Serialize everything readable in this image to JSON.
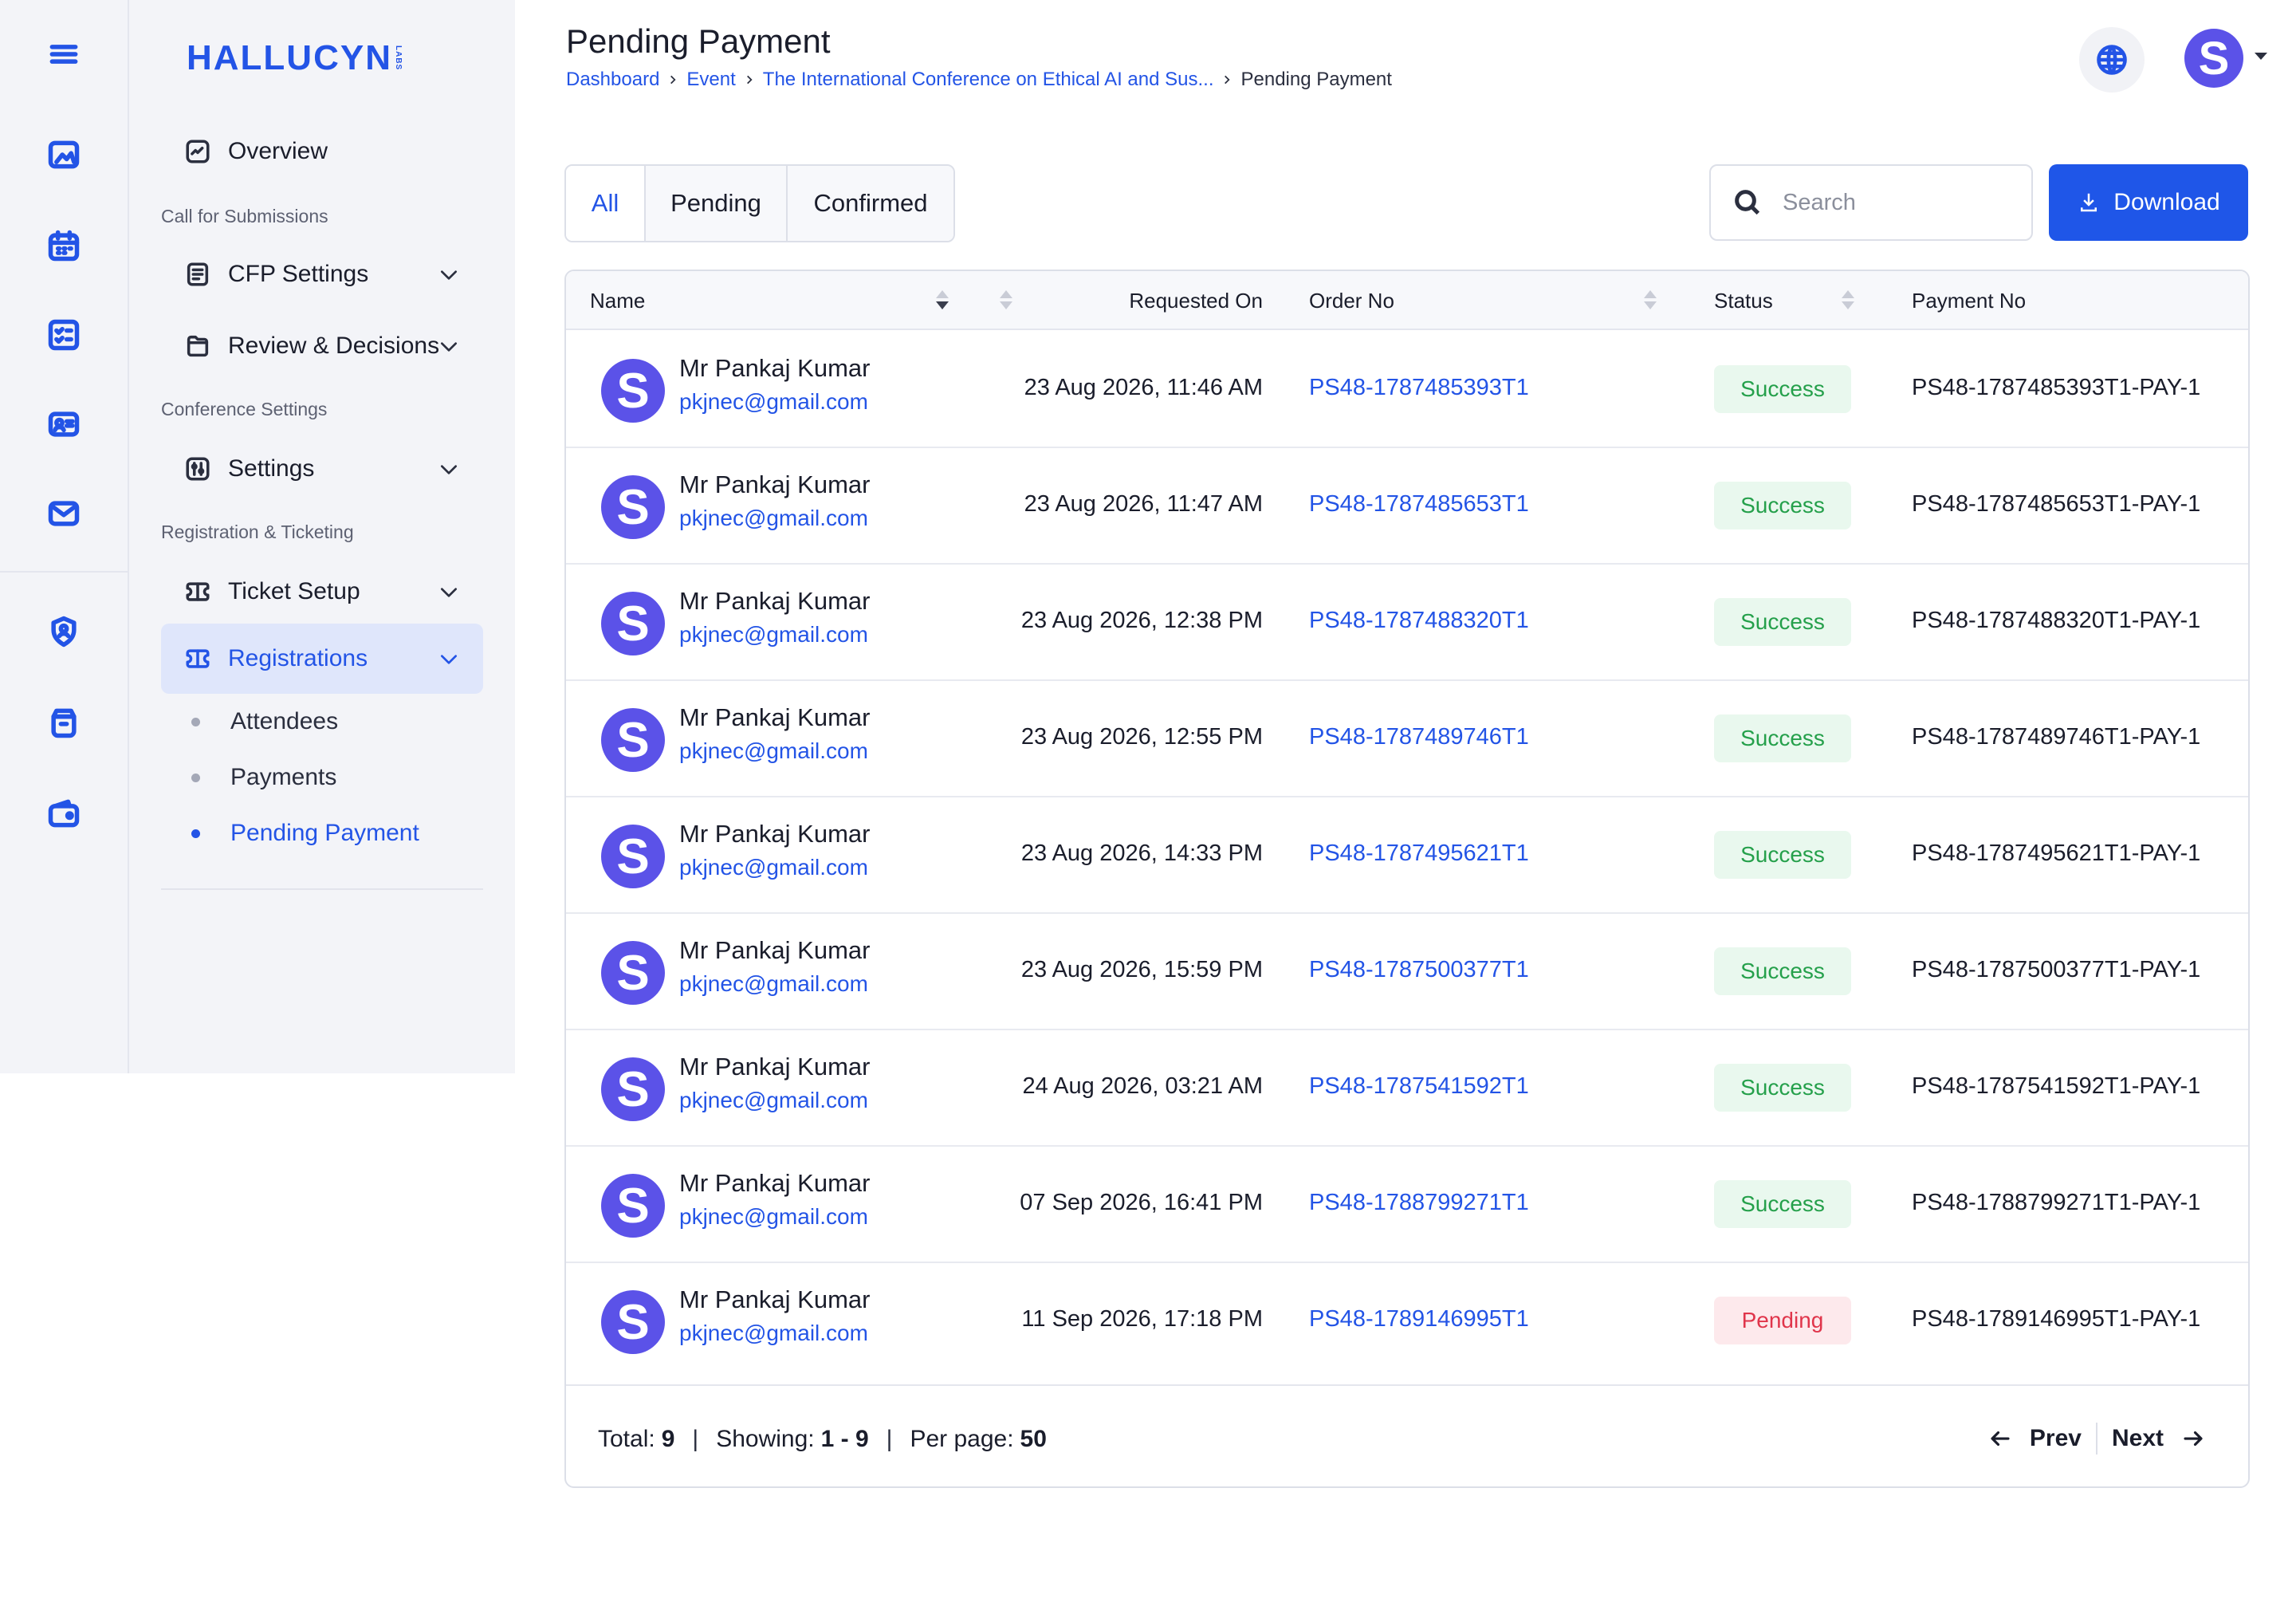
{
  "brand": {
    "name": "HALLUCYN",
    "suffix": "LABS",
    "color": "#2354e6"
  },
  "rail": {
    "icons": [
      "menu-icon",
      "image-icon",
      "calendar-icon",
      "checklist-icon",
      "id-card-icon",
      "mail-icon",
      "shield-user-icon",
      "archive-icon",
      "wallet-icon"
    ]
  },
  "sidebar": {
    "overview": "Overview",
    "section_cfs": "Call for Submissions",
    "cfp_settings": "CFP Settings",
    "review_decisions": "Review & Decisions",
    "section_conf": "Conference Settings",
    "settings": "Settings",
    "section_reg": "Registration & Ticketing",
    "ticket_setup": "Ticket Setup",
    "registrations": "Registrations",
    "sub_items": [
      "Attendees",
      "Payments",
      "Pending Payment"
    ],
    "active_sub": "Pending Payment"
  },
  "header": {
    "title": "Pending Payment",
    "breadcrumb": [
      "Dashboard",
      "Event",
      "The International Conference on Ethical AI and Sus...",
      "Pending Payment"
    ],
    "user_initial": "S"
  },
  "tabs": [
    {
      "label": "All",
      "active": true
    },
    {
      "label": "Pending",
      "active": false
    },
    {
      "label": "Confirmed",
      "active": false
    }
  ],
  "search": {
    "placeholder": "Search",
    "value": ""
  },
  "download_label": "Download",
  "table": {
    "columns": {
      "name": "Name",
      "requested_on": "Requested On",
      "order_no": "Order No",
      "status": "Status",
      "payment_no": "Payment No"
    },
    "rows": [
      {
        "initial": "S",
        "name": "Mr Pankaj Kumar",
        "email": "pkjnec@gmail.com",
        "requested_on": "23 Aug 2026, 11:46 AM",
        "order_no": "PS48-1787485393T1",
        "status": "Success",
        "payment_no": "PS48-1787485393T1-PAY-1"
      },
      {
        "initial": "S",
        "name": "Mr Pankaj Kumar",
        "email": "pkjnec@gmail.com",
        "requested_on": "23 Aug 2026, 11:47 AM",
        "order_no": "PS48-1787485653T1",
        "status": "Success",
        "payment_no": "PS48-1787485653T1-PAY-1"
      },
      {
        "initial": "S",
        "name": "Mr Pankaj Kumar",
        "email": "pkjnec@gmail.com",
        "requested_on": "23 Aug 2026, 12:38 PM",
        "order_no": "PS48-1787488320T1",
        "status": "Success",
        "payment_no": "PS48-1787488320T1-PAY-1"
      },
      {
        "initial": "S",
        "name": "Mr Pankaj Kumar",
        "email": "pkjnec@gmail.com",
        "requested_on": "23 Aug 2026, 12:55 PM",
        "order_no": "PS48-1787489746T1",
        "status": "Success",
        "payment_no": "PS48-1787489746T1-PAY-1"
      },
      {
        "initial": "S",
        "name": "Mr Pankaj Kumar",
        "email": "pkjnec@gmail.com",
        "requested_on": "23 Aug 2026, 14:33 PM",
        "order_no": "PS48-1787495621T1",
        "status": "Success",
        "payment_no": "PS48-1787495621T1-PAY-1"
      },
      {
        "initial": "S",
        "name": "Mr Pankaj Kumar",
        "email": "pkjnec@gmail.com",
        "requested_on": "23 Aug 2026, 15:59 PM",
        "order_no": "PS48-1787500377T1",
        "status": "Success",
        "payment_no": "PS48-1787500377T1-PAY-1"
      },
      {
        "initial": "S",
        "name": "Mr Pankaj Kumar",
        "email": "pkjnec@gmail.com",
        "requested_on": "24 Aug 2026, 03:21 AM",
        "order_no": "PS48-1787541592T1",
        "status": "Success",
        "payment_no": "PS48-1787541592T1-PAY-1"
      },
      {
        "initial": "S",
        "name": "Mr Pankaj Kumar",
        "email": "pkjnec@gmail.com",
        "requested_on": "07 Sep 2026, 16:41 PM",
        "order_no": "PS48-1788799271T1",
        "status": "Success",
        "payment_no": "PS48-1788799271T1-PAY-1"
      },
      {
        "initial": "S",
        "name": "Mr Pankaj Kumar",
        "email": "pkjnec@gmail.com",
        "requested_on": "11 Sep 2026, 17:18 PM",
        "order_no": "PS48-1789146995T1",
        "status": "Pending",
        "payment_no": "PS48-1789146995T1-PAY-1"
      }
    ]
  },
  "footer": {
    "total_label": "Total:",
    "total": "9",
    "showing_label": "Showing:",
    "showing": "1 - 9",
    "per_page_label": "Per page:",
    "per_page": "50",
    "prev": "Prev",
    "next": "Next"
  },
  "colors": {
    "accent": "#2354e6",
    "avatar": "#5b52e8",
    "success": "#25a04b",
    "pending": "#e0354b"
  }
}
